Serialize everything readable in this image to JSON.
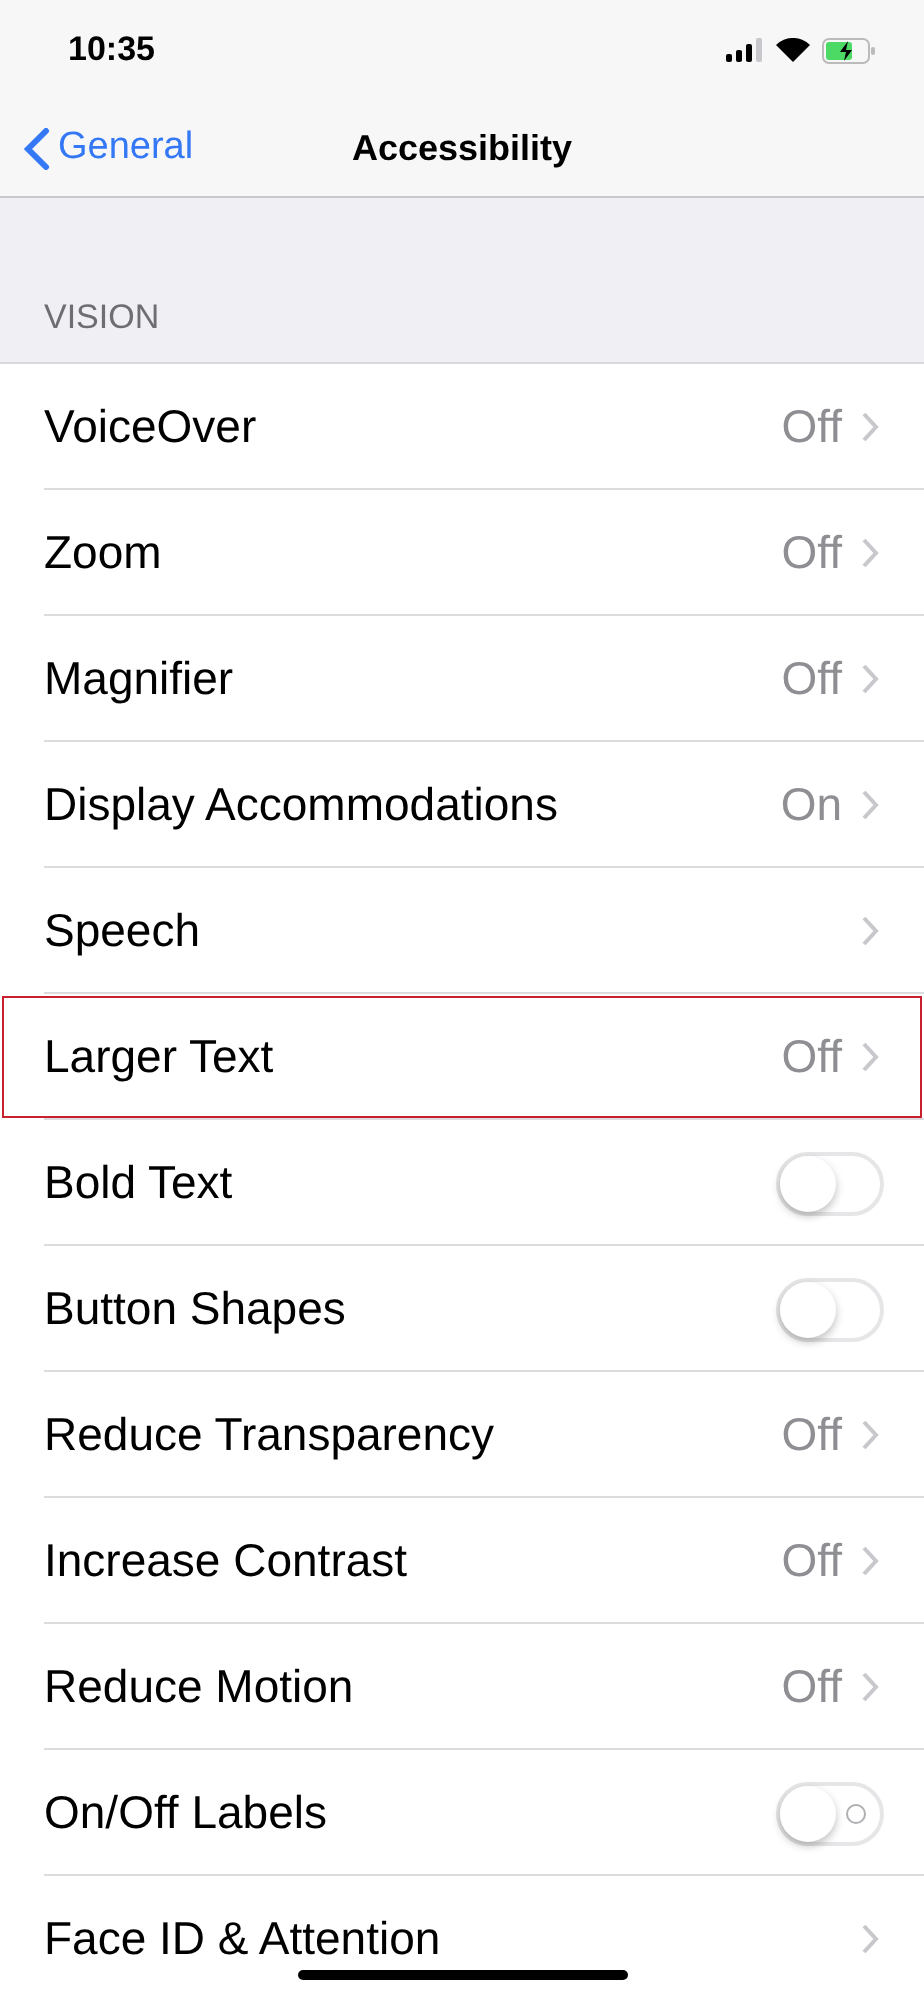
{
  "status_bar": {
    "time": "10:35",
    "battery_charging": true
  },
  "nav": {
    "back": "General",
    "title": "Accessibility"
  },
  "section": {
    "header": "VISION"
  },
  "rows": [
    {
      "kind": "link",
      "label": "VoiceOver",
      "value": "Off",
      "highlighted": false
    },
    {
      "kind": "link",
      "label": "Zoom",
      "value": "Off",
      "highlighted": false
    },
    {
      "kind": "link",
      "label": "Magnifier",
      "value": "Off",
      "highlighted": false
    },
    {
      "kind": "link",
      "label": "Display Accommodations",
      "value": "On",
      "highlighted": false
    },
    {
      "kind": "link",
      "label": "Speech",
      "highlighted": false
    },
    {
      "kind": "link",
      "label": "Larger Text",
      "value": "Off",
      "highlighted": true
    },
    {
      "kind": "toggle",
      "label": "Bold Text",
      "on": false,
      "off_label": false,
      "highlighted": false
    },
    {
      "kind": "toggle",
      "label": "Button Shapes",
      "on": false,
      "off_label": false,
      "highlighted": false
    },
    {
      "kind": "link",
      "label": "Reduce Transparency",
      "value": "Off",
      "highlighted": false
    },
    {
      "kind": "link",
      "label": "Increase Contrast",
      "value": "Off",
      "highlighted": false
    },
    {
      "kind": "link",
      "label": "Reduce Motion",
      "value": "Off",
      "highlighted": false
    },
    {
      "kind": "toggle",
      "label": "On/Off Labels",
      "on": false,
      "off_label": true,
      "highlighted": false
    },
    {
      "kind": "link",
      "label": "Face ID & Attention",
      "highlighted": false
    }
  ]
}
